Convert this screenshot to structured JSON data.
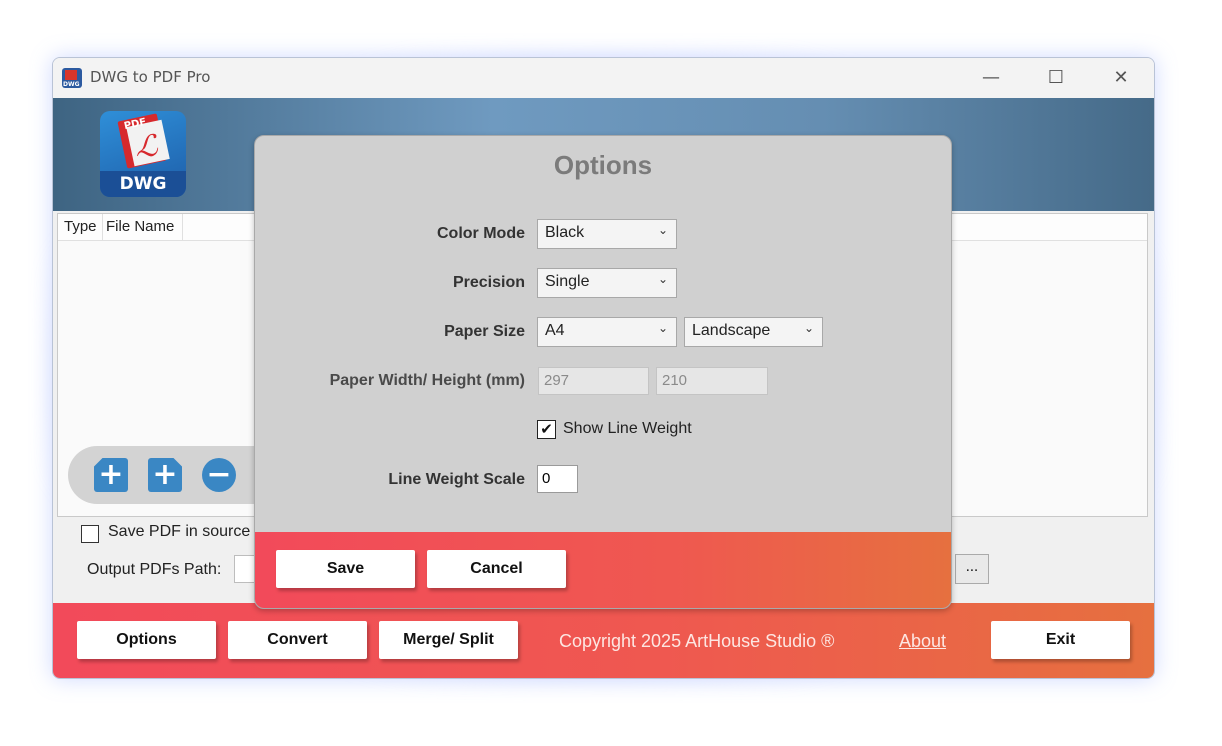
{
  "window": {
    "title": "DWG to PDF Pro",
    "controls": {
      "minimize": "—",
      "maximize": "☐",
      "close": "✕"
    }
  },
  "logo": {
    "pdf_tag": "PDF",
    "acrobat": "ℒ",
    "dwg_label": "DWG"
  },
  "file_list": {
    "columns": [
      "Type",
      "File Name"
    ]
  },
  "toolbar": {
    "add_folder_glyph": "+",
    "add_file_glyph": "+",
    "remove_glyph": "−"
  },
  "save_in_source_label": "Save PDF in source",
  "output_path_label": "Output PDFs Path:",
  "browse_label": "...",
  "bottom_bar": {
    "options_label": "Options",
    "convert_label": "Convert",
    "merge_split_label": "Merge/ Split",
    "copyright": "Copyright 2025 ArtHouse Studio ®",
    "about_label": "About",
    "exit_label": "Exit"
  },
  "options_dialog": {
    "title": "Options",
    "color_mode": {
      "label": "Color Mode",
      "value": "Black"
    },
    "precision": {
      "label": "Precision",
      "value": "Single"
    },
    "paper_size": {
      "label": "Paper Size",
      "value": "A4",
      "orientation": "Landscape"
    },
    "paper_dimensions": {
      "label": "Paper Width/ Height (mm)",
      "width": "297",
      "height": "210"
    },
    "show_line_weight": {
      "label": "Show Line Weight",
      "checked": true,
      "check_glyph": "✔"
    },
    "line_weight_scale": {
      "label": "Line Weight Scale",
      "value": "0"
    },
    "chevron": "⌄",
    "save_label": "Save",
    "cancel_label": "Cancel"
  }
}
